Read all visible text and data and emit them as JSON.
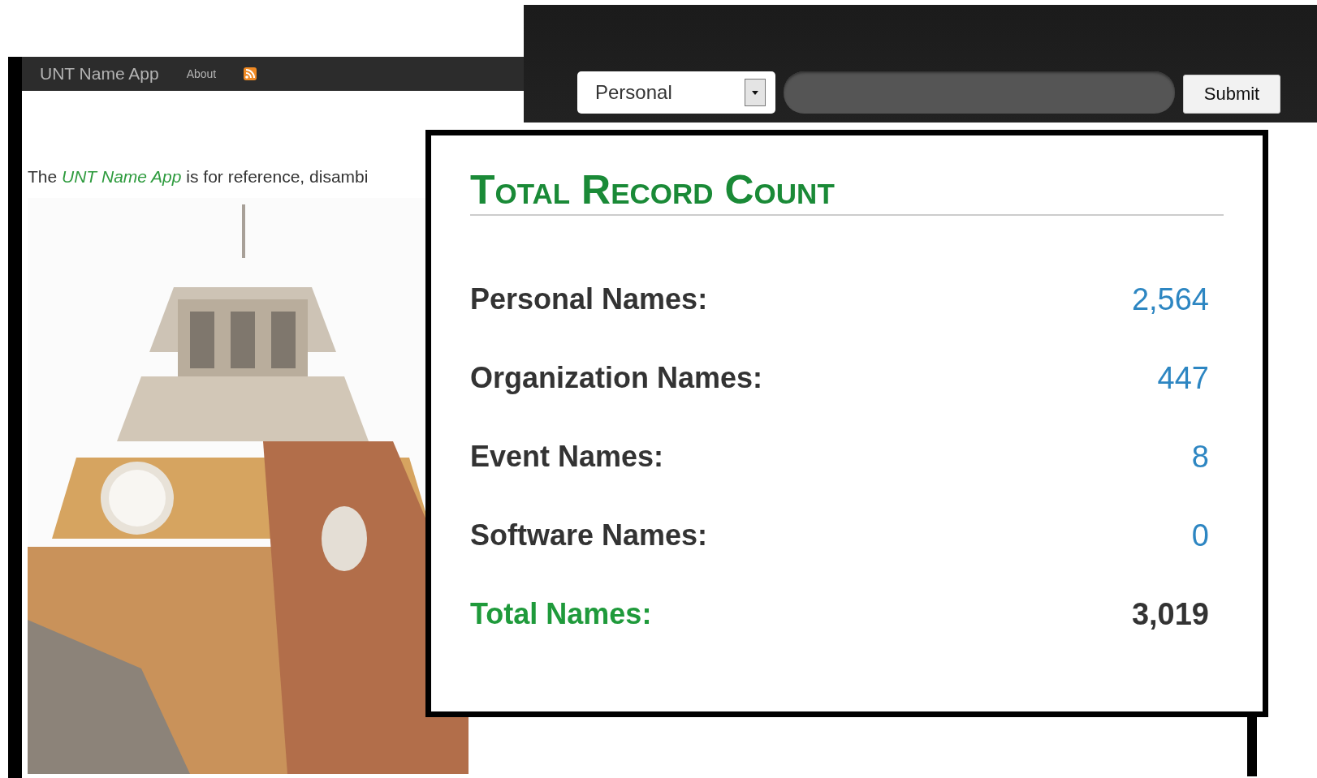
{
  "app_window": {
    "brand": "UNT Name App",
    "nav": [
      {
        "label": "About"
      }
    ],
    "intro": {
      "text": "The *UNT Name App* is for reference, disambi"
    }
  },
  "search_bar": {
    "type_select": {
      "value": "Personal"
    },
    "submit": "Submit"
  },
  "record_count": {
    "title": "Total Record Count",
    "rows": [
      {
        "label": "Personal Names:",
        "value": "2,564",
        "kind": "count"
      },
      {
        "label": "Organization Names:",
        "value": "447",
        "kind": "count"
      },
      {
        "label": "Event Names:",
        "value": "8",
        "kind": "count"
      },
      {
        "label": "Software Names:",
        "value": "0",
        "kind": "count"
      },
      {
        "label": "Total Names:",
        "value": "3,019",
        "kind": "total"
      }
    ]
  }
}
